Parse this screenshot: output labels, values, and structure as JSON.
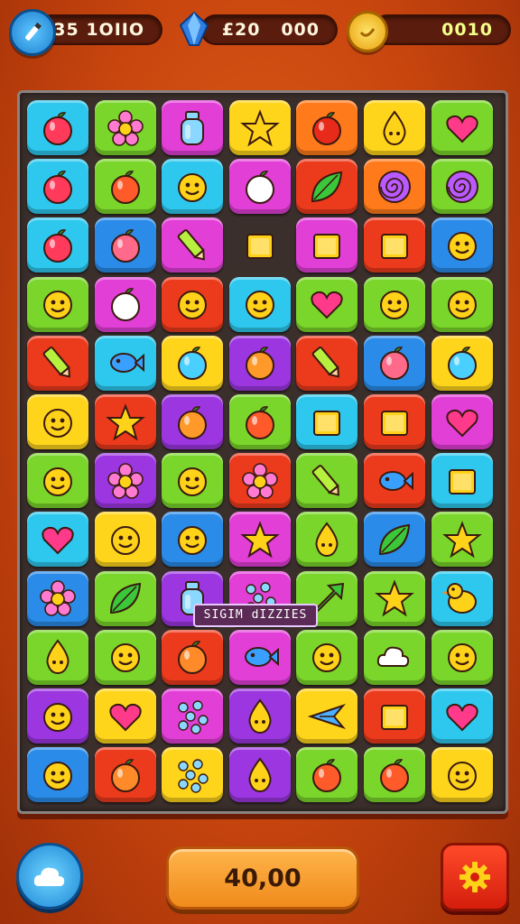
{
  "hud": {
    "pencil_counter": "535 1OIIO",
    "gem_counter": "£20   000",
    "coin_counter": "0010",
    "left_icon": "pencil-icon",
    "middle_icon": "gem-icon",
    "right_icon": "coin-icon"
  },
  "board": {
    "rows": 12,
    "cols": 7,
    "tiles": [
      [
        "cyan:apple",
        "lime:flower",
        "magenta:bottle",
        "yellow:star",
        "orange:apple",
        "yellow:drop",
        "lime:heart"
      ],
      [
        "cyan:apple",
        "lime:apple",
        "cyan:face",
        "magenta:apple",
        "red:leaf",
        "orange:swirl",
        "lime:swirl"
      ],
      [
        "cyan:apple",
        "blue:apple",
        "magenta:pencil",
        "dark:box",
        "magenta:box",
        "red:box",
        "blue:face"
      ],
      [
        "lime:face",
        "magenta:apple",
        "red:face",
        "cyan:face",
        "lime:heart",
        "lime:face",
        "lime:face"
      ],
      [
        "red:pencil",
        "cyan:fish",
        "yellow:apple",
        "purple:apple",
        "red:pencil",
        "blue:apple",
        "yellow:apple"
      ],
      [
        "yellow:face",
        "red:star",
        "purple:apple",
        "lime:apple",
        "cyan:box",
        "red:box",
        "magenta:heart"
      ],
      [
        "lime:face",
        "purple:flower",
        "lime:face",
        "red:flower",
        "lime:pencil",
        "red:fish",
        "cyan:box"
      ],
      [
        "cyan:heart",
        "yellow:face",
        "blue:face",
        "magenta:star",
        "lime:drop",
        "blue:leaf",
        "lime:star"
      ],
      [
        "blue:flower",
        "lime:leaf",
        "purple:bottle",
        "magenta:dots",
        "lime:arrow",
        "lime:star",
        "cyan:bird"
      ],
      [
        "lime:drop",
        "lime:face",
        "red:apple",
        "magenta:fish",
        "lime:face",
        "lime:cloud",
        "lime:face"
      ],
      [
        "purple:face",
        "yellow:heart",
        "magenta:dots",
        "purple:drop",
        "yellow:plane",
        "red:box",
        "cyan:heart"
      ],
      [
        "blue:face",
        "red:apple",
        "yellow:dots",
        "purple:drop",
        "lime:apple",
        "lime:apple",
        "yellow:face"
      ]
    ]
  },
  "banner_text": "SIGIM dIZZIES",
  "bottom": {
    "score_label": "40,00",
    "left_button_icon": "cloud-icon",
    "right_button_icon": "settings-gear-icon"
  },
  "colors": {
    "background": "#d2500f",
    "tile_cyan": "#2ec8ee",
    "tile_lime": "#7ad62a",
    "tile_magenta": "#e23fd7",
    "tile_yellow": "#ffd51c",
    "tile_orange": "#ff7a1a",
    "tile_red": "#ec3a1c",
    "tile_blue": "#2a8be8",
    "tile_purple": "#9b36e0",
    "tile_dark": "#3b2f2c"
  }
}
